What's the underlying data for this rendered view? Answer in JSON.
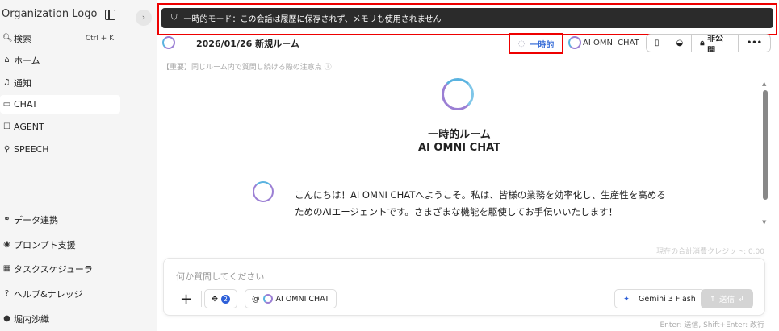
{
  "sidebar": {
    "logo_alt": "Organization Logo",
    "search": {
      "label": "検索",
      "shortcut": "Ctrl + K"
    },
    "items": [
      {
        "label": "ホーム",
        "icon": "home-icon"
      },
      {
        "label": "通知",
        "icon": "bell-icon"
      },
      {
        "label": "CHAT",
        "icon": "chat-icon",
        "active": true
      },
      {
        "label": "AGENT",
        "icon": "robot-icon"
      },
      {
        "label": "SPEECH",
        "icon": "microphone-icon"
      }
    ],
    "bottom_items": [
      {
        "label": "データ連携",
        "icon": "link-icon"
      },
      {
        "label": "プロンプト支援",
        "icon": "prompt-icon"
      },
      {
        "label": "タスクスケジューラ",
        "icon": "calendar-icon"
      },
      {
        "label": "ヘルプ&ナレッジ",
        "icon": "help-icon"
      },
      {
        "label": "堀内沙織",
        "icon": "user-icon"
      }
    ]
  },
  "banner": {
    "text": "一時的モード：この会話は履歴に保存されず、メモリも使用されません",
    "icon": "shield-icon"
  },
  "header": {
    "room_title": "2026/01/26 新規ルーム",
    "temporary_label": "一時的",
    "agent_name": "AI OMNI CHAT",
    "privacy_label": "非公開"
  },
  "notice": "【重要】同じルーム内で質問し続ける際の注意点",
  "welcome": {
    "title": "一時的ルーム",
    "subtitle": "AI OMNI CHAT"
  },
  "message": "こんにちは！AI OMNI CHATへようこそ。私は、皆様の業務を効率化し、生産性を高めるためのAIエージェントです。さまざまな機能を駆使してお手伝いいたします！",
  "credit": "現在の合計消費クレジット: 0.00",
  "composer": {
    "placeholder": "何か質問してください",
    "plugin_count": "2",
    "agent_chip": "AI OMNI CHAT",
    "model": "Gemini 3 Flash",
    "send_label": "送信",
    "hint": "Enter: 送信, Shift+Enter: 改行"
  },
  "colors": {
    "accent": "#2d5fd8",
    "highlight_border": "#ee0000",
    "banner_bg": "#2b2b2b"
  }
}
